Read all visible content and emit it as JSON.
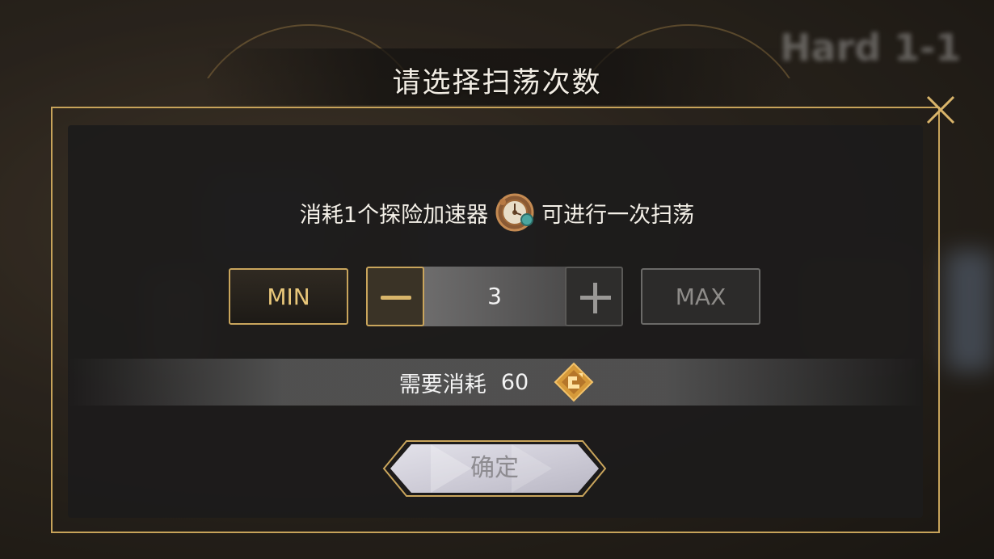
{
  "dialog": {
    "title": "请选择扫荡次数",
    "description_before": "消耗1个探险加速器",
    "description_after": "可进行一次扫荡",
    "item_icon": "accelerator-gear-icon",
    "min_label": "MIN",
    "max_label": "MAX",
    "count": "3",
    "cost_label": "需要消耗",
    "cost_value": "60",
    "cost_icon": "stamina-crystal-icon",
    "confirm_label": "确定"
  },
  "background": {
    "stage_label": "Hard 1-1"
  },
  "colors": {
    "gold_accent": "#c9a55c",
    "panel": "#1c1b1b",
    "text": "#f3f3f3"
  }
}
